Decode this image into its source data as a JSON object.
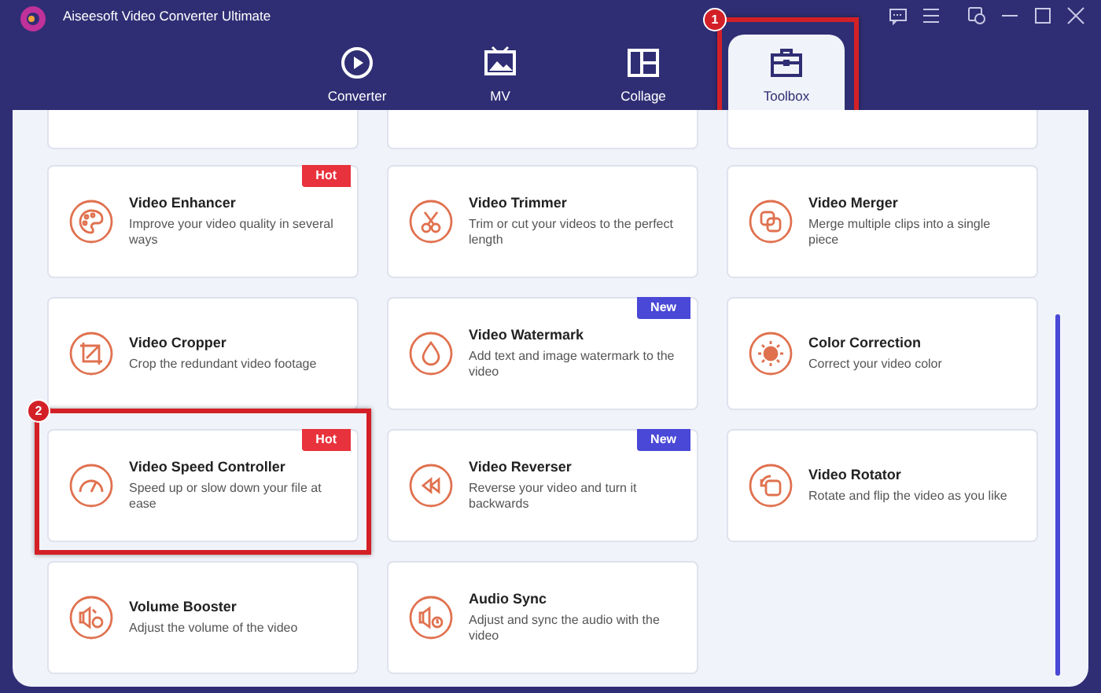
{
  "window": {
    "title": "Aiseesoft Video Converter Ultimate"
  },
  "tabs": [
    {
      "label": "Converter",
      "selected": false
    },
    {
      "label": "MV",
      "selected": false
    },
    {
      "label": "Collage",
      "selected": false
    },
    {
      "label": "Toolbox",
      "selected": true,
      "callout": "1"
    }
  ],
  "tools": [
    {
      "title": "Video Enhancer",
      "description": "Improve your video quality in several ways",
      "badge": {
        "text": "Hot",
        "kind": "hot"
      }
    },
    {
      "title": "Video Trimmer",
      "description": "Trim or cut your videos to the perfect length"
    },
    {
      "title": "Video Merger",
      "description": "Merge multiple clips into a single piece"
    },
    {
      "title": "Video Cropper",
      "description": "Crop the redundant video footage"
    },
    {
      "title": "Video Watermark",
      "description": "Add text and image watermark to the video",
      "badge": {
        "text": "New",
        "kind": "new"
      }
    },
    {
      "title": "Color Correction",
      "description": "Correct your video color"
    },
    {
      "title": "Video Speed Controller",
      "description": "Speed up or slow down your file at ease",
      "badge": {
        "text": "Hot",
        "kind": "hot"
      },
      "callout": "2"
    },
    {
      "title": "Video Reverser",
      "description": "Reverse your video and turn it backwards",
      "badge": {
        "text": "New",
        "kind": "new"
      }
    },
    {
      "title": "Video Rotator",
      "description": "Rotate and flip the video as you like"
    },
    {
      "title": "Volume Booster",
      "description": "Adjust the volume of the video"
    },
    {
      "title": "Audio Sync",
      "description": "Adjust and sync the audio with the video"
    }
  ]
}
